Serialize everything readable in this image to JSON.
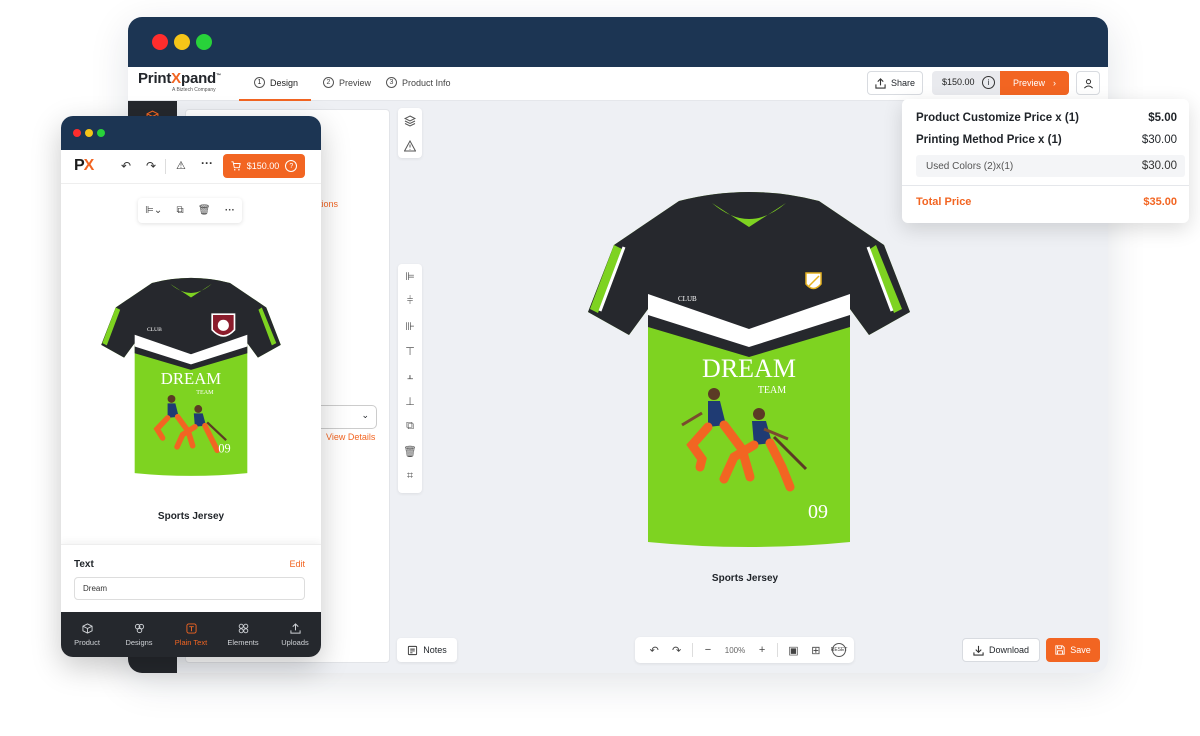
{
  "desktop": {
    "logo": {
      "name_a": "Print",
      "name_x": "X",
      "name_b": "pand",
      "tm": "™",
      "tagline": "A Biztech Company"
    },
    "steps": [
      {
        "num": "1",
        "label": "Design"
      },
      {
        "num": "2",
        "label": "Preview"
      },
      {
        "num": "3",
        "label": "Product Info"
      }
    ],
    "share_label": "Share",
    "price": "$150.00",
    "preview_label": "Preview",
    "panel_fragments": {
      "options": "tions",
      "view_details": "View Details"
    },
    "jersey": {
      "club": "CLUB",
      "dream": "DREAM",
      "team": "TEAM",
      "number": "09",
      "name": "Sports Jersey"
    },
    "notes_label": "Notes",
    "zoom": {
      "value": "100%",
      "reset": "RESET"
    },
    "download_label": "Download",
    "save_label": "Save"
  },
  "price_popup": {
    "rows": [
      {
        "label": "Product Customize Price  x  (1)",
        "value": "$5.00"
      },
      {
        "label": "Printing Method Price  x  (1)",
        "value": "$30.00"
      }
    ],
    "sub": {
      "label": "Used Colors (2)x(1)",
      "value": "$30.00"
    },
    "total": {
      "label": "Total Price",
      "value": "$35.00"
    }
  },
  "mobile": {
    "logo": {
      "p": "P",
      "x": "X"
    },
    "cart_price": "$150.00",
    "jersey": {
      "club": "CLUB",
      "dream": "DREAM",
      "team": "TEAM",
      "number": "09",
      "name": "Sports Jersey"
    },
    "text_card": {
      "title": "Text",
      "edit": "Edit",
      "value": "Dream"
    },
    "nav": [
      {
        "label": "Product",
        "icon": "cube-icon"
      },
      {
        "label": "Designs",
        "icon": "designs-icon"
      },
      {
        "label": "Plain Text",
        "icon": "text-icon"
      },
      {
        "label": "Elements",
        "icon": "elements-icon"
      },
      {
        "label": "Uploads",
        "icon": "upload-icon"
      }
    ]
  },
  "colors": {
    "accent": "#f26522",
    "titlebar": "#1c3553",
    "jersey_green": "#7ed321",
    "jersey_dark": "#26282d"
  }
}
